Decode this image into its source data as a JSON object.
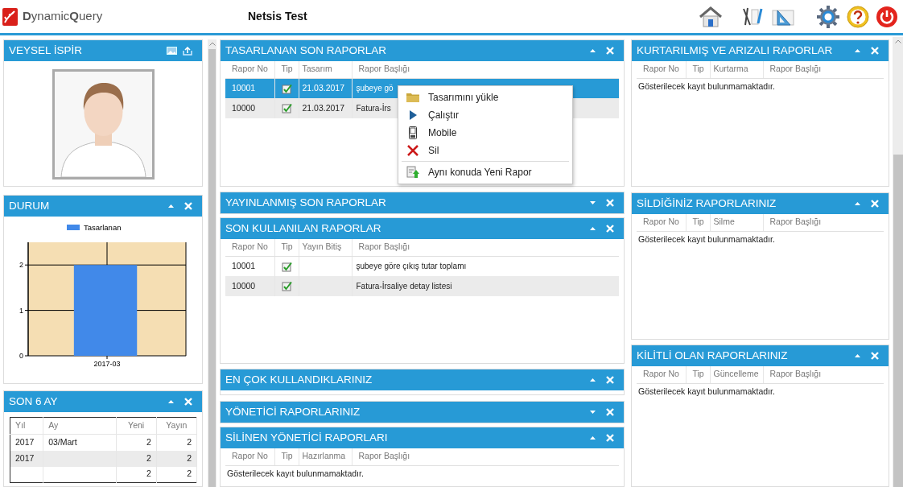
{
  "app": {
    "logo": "**D**ynamic**Q**uery",
    "title": "Netsis Test"
  },
  "columns": [
    {
      "panels": [
        {
          "kind": "profile",
          "title": "VEYSEL İSPİR"
        },
        {
          "kind": "chart",
          "title": "DURUM",
          "collapsed": false,
          "chart_data": {
            "type": "bar",
            "categories": [
              "2017-03"
            ],
            "series": [
              {
                "name": "Tasarlanan",
                "color": "#4189e9",
                "values": [
                  2
                ]
              }
            ],
            "ylim": [
              0,
              2.5
            ],
            "yticks": [
              0,
              1,
              2
            ],
            "grid": true
          }
        },
        {
          "kind": "months",
          "title": "SON 6 AY",
          "collapsed": false,
          "columns": [
            "Yıl",
            "Ay",
            "Yeni",
            "Yayın"
          ],
          "rows": [
            {
              "year": "2017",
              "month": "03/Mart",
              "new": "2",
              "published": "2"
            },
            {
              "year": "2017",
              "new": "2",
              "published": "2"
            },
            {
              "new": "2",
              "published": "2"
            }
          ]
        }
      ]
    },
    {
      "panels": [
        {
          "kind": "reports",
          "title": "TASARLANAN SON RAPORLAR",
          "collapsed": false,
          "columns": [
            "Rapor No",
            "Tip",
            "Tasarım",
            "Rapor Başlığı"
          ],
          "rows": [
            {
              "no": "10001",
              "checked": true,
              "date": "21.03.2017",
              "title": "şubeye gö",
              "selected": true
            },
            {
              "no": "10000",
              "checked": true,
              "date": "21.03.2017",
              "title": "Fatura-İrs",
              "selected": false
            }
          ],
          "context_menu": {
            "items": [
              {
                "label": "Tasarımını yükle",
                "kind": "folder",
                "divider_above": false
              },
              {
                "label": "Çalıştır",
                "kind": "run",
                "divider_above": false
              },
              {
                "label": "Mobile",
                "kind": "mobile",
                "divider_above": false
              },
              {
                "label": "Sil",
                "kind": "delete",
                "divider_above": false
              },
              {
                "label": "Aynı konuda Yeni Rapor",
                "kind": "new",
                "divider_above": true
              }
            ]
          }
        },
        {
          "kind": "reports",
          "title": "YAYINLANMIŞ SON RAPORLAR",
          "collapsed": true
        },
        {
          "kind": "reports",
          "title": "SON KULLANILAN RAPORLAR",
          "collapsed": false,
          "columns": [
            "Rapor No",
            "Tip",
            "Yayın Bitiş",
            "Rapor Başlığı"
          ],
          "rows": [
            {
              "no": "10001",
              "checked": true,
              "title": "şubeye göre çıkış tutar toplamı",
              "selected": false
            },
            {
              "no": "10000",
              "checked": true,
              "title": "Fatura-İrsaliye detay listesi",
              "selected": false
            }
          ]
        },
        {
          "kind": "reports",
          "title": "EN ÇOK KULLANDIKLARINIZ",
          "collapsed": false
        },
        {
          "kind": "reports",
          "title": "YÖNETİCİ RAPORLARINIZ",
          "collapsed": true
        },
        {
          "kind": "reports",
          "title": "SİLİNEN YÖNETİCİ RAPORLARI",
          "collapsed": false,
          "columns": [
            "Rapor No",
            "Tip",
            "Hazırlanma",
            "Rapor Başlığı"
          ],
          "empty_text": "Gösterilecek kayıt bulunmamaktadır."
        }
      ]
    },
    {
      "panels": [
        {
          "kind": "reports",
          "title": "KURTARILMIŞ VE ARIZALI RAPORLAR",
          "collapsed": false,
          "columns": [
            "Rapor No",
            "Tip",
            "Kurtarma",
            "Rapor Başlığı"
          ],
          "empty_text": "Gösterilecek kayıt bulunmamaktadır."
        },
        {
          "kind": "reports",
          "title": "SİLDİĞİNİZ RAPORLARINIZ",
          "collapsed": false,
          "columns": [
            "Rapor No",
            "Tip",
            "Silme",
            "Rapor Başlığı"
          ],
          "empty_text": "Gösterilecek kayıt bulunmamaktadır."
        },
        {
          "kind": "reports",
          "title": "KİLİTLİ OLAN RAPORLARINIZ",
          "collapsed": false,
          "columns": [
            "Rapor No",
            "Tip",
            "Güncelleme",
            "Rapor Başlığı"
          ],
          "empty_text": "Gösterilecek kayıt bulunmamaktadır."
        }
      ]
    }
  ]
}
